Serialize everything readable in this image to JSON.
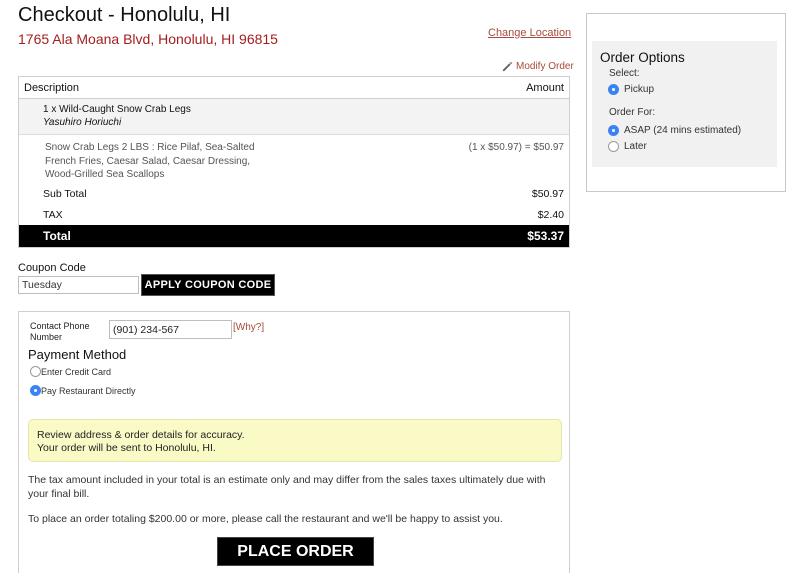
{
  "header": {
    "title": "Checkout - Honolulu, HI",
    "address": "1765 Ala Moana Blvd, Honolulu, HI 96815",
    "change_location": "Change Location",
    "modify_order": "Modify Order"
  },
  "order": {
    "columns": [
      "Description",
      "Amount"
    ],
    "item": {
      "name": "1 x Wild-Caught Snow Crab Legs",
      "recipient": "Yasuhiro Horiuchi",
      "details": "Snow Crab Legs 2 LBS : Rice Pilaf, Sea-Salted French Fries, Caesar Salad, Caesar Dressing, Wood-Grilled Sea Scallops",
      "price": "(1 x $50.97) = $50.97"
    },
    "subtotal": {
      "label": "Sub Total",
      "value": "$50.97"
    },
    "tax": {
      "label": "TAX",
      "value": "$2.40"
    },
    "total": {
      "label": "Total",
      "value": "$53.37"
    }
  },
  "coupon": {
    "label": "Coupon Code",
    "value": "Tuesday",
    "button": "APPLY COUPON CODE"
  },
  "contact": {
    "phone_label": "Contact Phone Number",
    "phone_value": "(901) 234-567",
    "why_link": "[Why?]"
  },
  "payment": {
    "heading": "Payment Method",
    "options": [
      {
        "label": "Enter Credit Card",
        "selected": false
      },
      {
        "label": "Pay Restaurant Directly",
        "selected": true
      }
    ]
  },
  "notice": {
    "line1": "Review address & order details for accuracy.",
    "line2": "Your order will be sent to Honolulu, HI."
  },
  "tax_note": "The tax amount included in your total is an estimate only and may differ from the sales taxes ultimately due with your final bill.",
  "large_order_note": "To place an order totaling $200.00 or more, please call the restaurant and we'll be happy to assist you.",
  "place_order": "PLACE ORDER",
  "order_options": {
    "title": "Order Options",
    "select_label": "Select:",
    "select_options": [
      {
        "label": "Pickup",
        "selected": true
      }
    ],
    "order_for_label": "Order For:",
    "order_for_options": [
      {
        "label": "ASAP (24 mins estimated)",
        "selected": true
      },
      {
        "label": "Later",
        "selected": false
      }
    ]
  },
  "colors": {
    "address_red": "#a31f1f",
    "link": "#a84a3a",
    "radio_selected": "#3b82f6",
    "notice_bg": "#fafac6"
  }
}
